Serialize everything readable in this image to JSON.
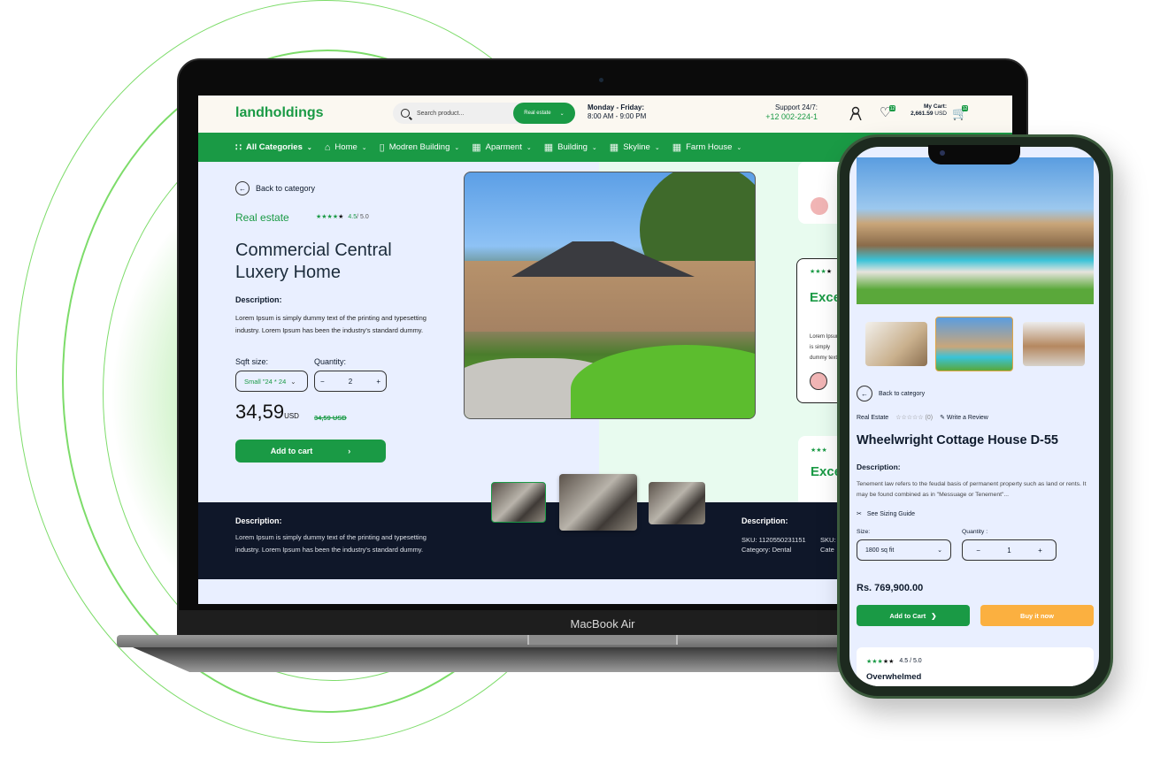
{
  "laptop": {
    "device_label": "MacBook Air"
  },
  "site": {
    "brand": "landholdings",
    "search": {
      "placeholder": "Search product...",
      "category": "Real estate"
    },
    "hours": {
      "title": "Monday - Friday:",
      "time": "8:00 AM - 9:00 PM"
    },
    "support": {
      "title": "Support 24/7:",
      "phone": "+12 002-224-1"
    },
    "wishlist_count": "12",
    "cart": {
      "label": "My Cart:",
      "amount": "2,661.59",
      "currency": "USD",
      "count": "12"
    },
    "nav": [
      {
        "label": "All Categories",
        "icon": "grid-icon"
      },
      {
        "label": "Home",
        "icon": "home-icon"
      },
      {
        "label": "Modren Building",
        "icon": "tower-icon"
      },
      {
        "label": "Aparment",
        "icon": "apartment-icon"
      },
      {
        "label": "Building",
        "icon": "building-icon"
      },
      {
        "label": "Skyline",
        "icon": "skyline-icon"
      },
      {
        "label": "Farm House",
        "icon": "farmhouse-icon"
      }
    ],
    "product": {
      "back_label": "Back to category",
      "category": "Real estate",
      "rating": "4.5",
      "rating_max": "/ 5.0",
      "stars_filled": 4,
      "title": "Commercial Central Luxery Home",
      "desc_label": "Description:",
      "desc": "Lorem Ipsum is simply dummy text of the printing and typesetting industry. Lorem Ipsum has been the industry's standard dummy.",
      "size_label": "Sqft size:",
      "size_value": "Small \"24 * 24",
      "qty_label": "Quantity:",
      "qty_value": "2",
      "price": "34,59",
      "price_currency": "USD",
      "old_price": "34,59 USD",
      "add_to_cart": "Add to cart"
    },
    "band": {
      "desc_label": "Description:",
      "desc": "Lorem Ipsum is simply dummy text of the printing and typesetting industry. Lorem Ipsum has been the industry's standard dummy.",
      "desc2_label": "Description:",
      "sku": "SKU: 1120550231151",
      "category": "Category: Dental",
      "sku2": "SKU:",
      "category2": "Cate"
    },
    "reviews": [
      {
        "title": "Excellent service",
        "text": "Lorem Ipsum is simply dummy text of the printing and typesetting industry. Lorem Ipsum has been the industry's"
      },
      {
        "title": "Excellent service"
      }
    ]
  },
  "phone": {
    "back_label": "Back to category",
    "category": "Real Estate",
    "review_count": "(0)",
    "write_review": "Write a Review",
    "title": "Wheelwright Cottage House D-55",
    "desc_label": "Description:",
    "desc": "Tenement law refers to the feudal basis of permanent property such as land or rents. It may be found combined as in \"Messuage or Tenement\"...",
    "sizing_guide": "See Sizing Guide",
    "size_label": "Size:",
    "size_value": "1800 sq fit",
    "qty_label": "Quantity :",
    "qty_value": "1",
    "price": "Rs. 769,900.00",
    "add_to_cart": "Add to Cart",
    "buy_now": "Buy it now",
    "review": {
      "rating": "4.5 / 5.0",
      "stars_filled": 3,
      "title": "Overwhelmed"
    }
  },
  "colors": {
    "brand_green": "#1a9a45",
    "dark_band": "#0f1729",
    "buy_orange": "#fbb040"
  }
}
